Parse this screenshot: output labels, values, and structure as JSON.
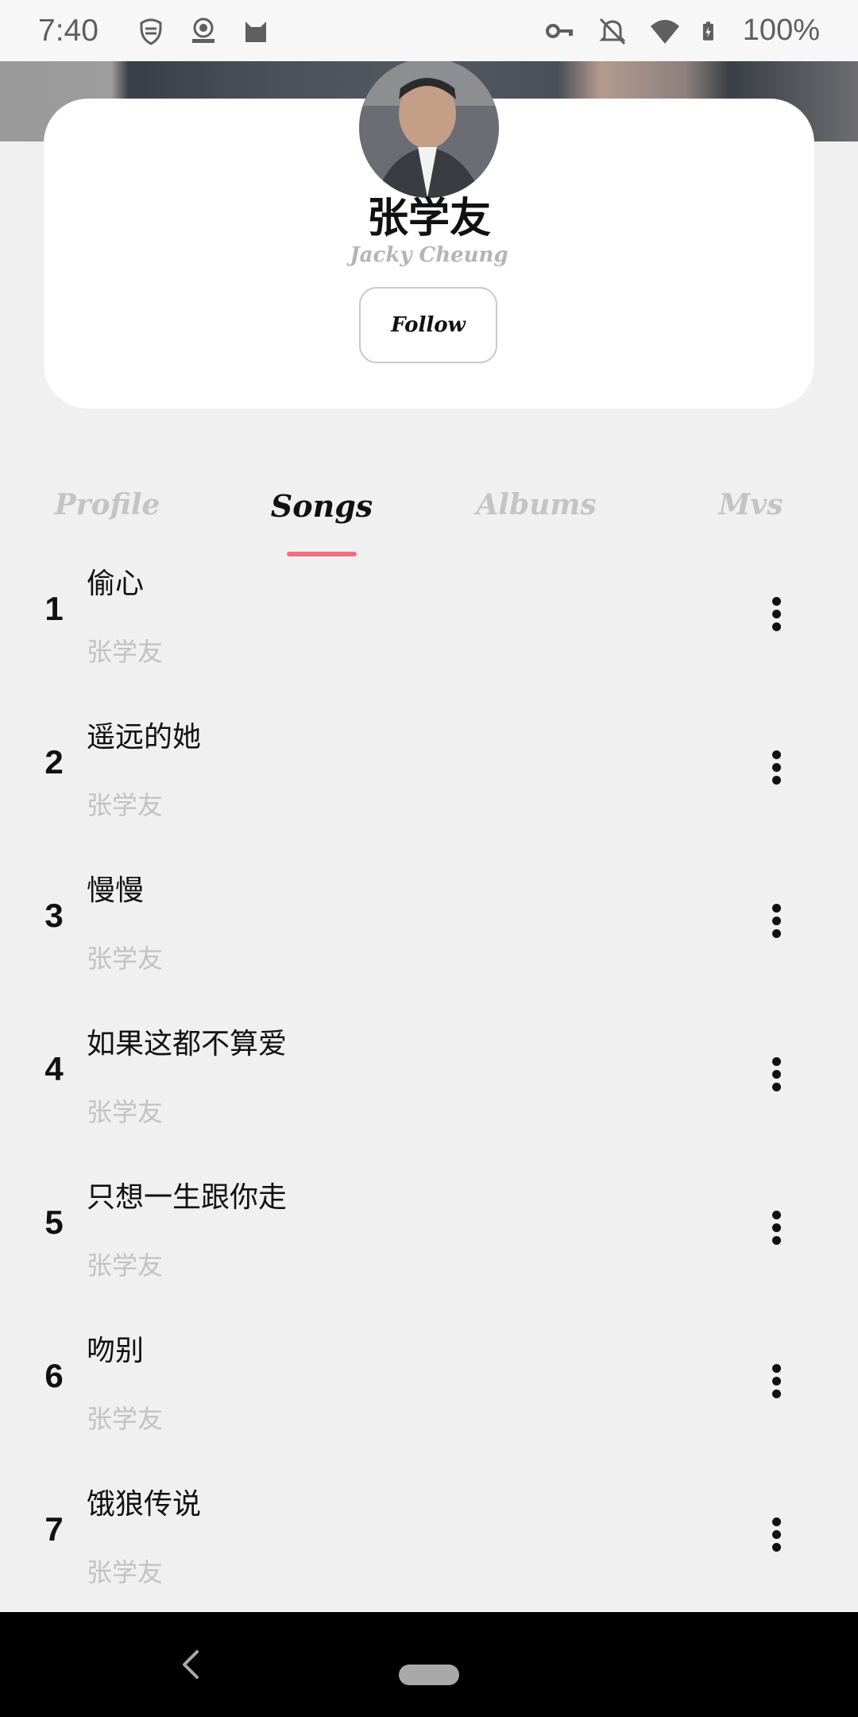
{
  "status_bar": {
    "time": "7:40",
    "battery": "100%",
    "left_icons": [
      "guard-icon",
      "qr-app-icon",
      "cat-app-icon"
    ],
    "right_icons": [
      "vpn-key-icon",
      "notifications-off-icon",
      "wifi-icon",
      "battery-charging-icon"
    ]
  },
  "artist": {
    "name": "张学友",
    "name_en": "Jacky Cheung",
    "follow_label": "Follow"
  },
  "tabs": [
    {
      "label": "Profile",
      "active": false
    },
    {
      "label": "Songs",
      "active": true
    },
    {
      "label": "Albums",
      "active": false
    },
    {
      "label": "Mvs",
      "active": false
    }
  ],
  "accent_color": "#f26f7f",
  "songs": [
    {
      "index": "1",
      "title": "偷心",
      "artist": "张学友"
    },
    {
      "index": "2",
      "title": "遥远的她",
      "artist": "张学友"
    },
    {
      "index": "3",
      "title": "慢慢",
      "artist": "张学友"
    },
    {
      "index": "4",
      "title": "如果这都不算爱",
      "artist": "张学友"
    },
    {
      "index": "5",
      "title": "只想一生跟你走",
      "artist": "张学友"
    },
    {
      "index": "6",
      "title": "吻别",
      "artist": "张学友"
    },
    {
      "index": "7",
      "title": "饿狼传说",
      "artist": "张学友"
    }
  ],
  "nav_bar": {
    "icons": [
      "back-icon",
      "home-pill-icon"
    ]
  }
}
